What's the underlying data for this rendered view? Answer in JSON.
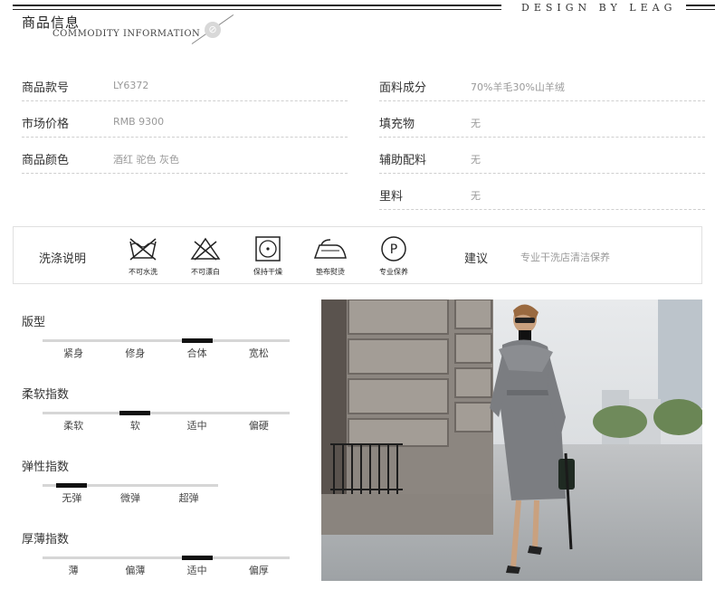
{
  "header": {
    "title": "商品信息",
    "subtitle": "COMMODITY INFORMATION",
    "brand": "DESIGN BY LEAG"
  },
  "info_left": [
    {
      "label": "商品款号",
      "value": "LY6372"
    },
    {
      "label": "市场价格",
      "value": "RMB 9300"
    },
    {
      "label": "商品颜色",
      "value": "酒红 驼色 灰色"
    }
  ],
  "info_right": [
    {
      "label": "面料成分",
      "value": "70%羊毛30%山羊绒"
    },
    {
      "label": "填充物",
      "value": "无"
    },
    {
      "label": "辅助配料",
      "value": "无"
    },
    {
      "label": "里料",
      "value": "无"
    }
  ],
  "care": {
    "label": "洗涤说明",
    "items": [
      {
        "icon": "no-wash-icon",
        "caption": "不可水洗"
      },
      {
        "icon": "no-bleach-icon",
        "caption": "不可漂白"
      },
      {
        "icon": "tumble-dry-icon",
        "caption": "保持干燥"
      },
      {
        "icon": "iron-icon",
        "caption": "垫布熨烫"
      },
      {
        "icon": "dry-clean-icon",
        "caption": "专业保养"
      }
    ],
    "advice_label": "建议",
    "advice_value": "专业干洗店清洁保养"
  },
  "scales": [
    {
      "title": "版型",
      "options": [
        "紧身",
        "修身",
        "合体",
        "宽松"
      ],
      "selected_index": 2
    },
    {
      "title": "柔软指数",
      "options": [
        "柔软",
        "软",
        "适中",
        "偏硬"
      ],
      "selected_index": 1
    },
    {
      "title": "弹性指数",
      "options": [
        "无弹",
        "微弹",
        "超弹"
      ],
      "selected_index": 0
    },
    {
      "title": "厚薄指数",
      "options": [
        "薄",
        "偏薄",
        "适中",
        "偏厚"
      ],
      "selected_index": 2
    }
  ],
  "photo": {
    "icon": "model-photo"
  }
}
